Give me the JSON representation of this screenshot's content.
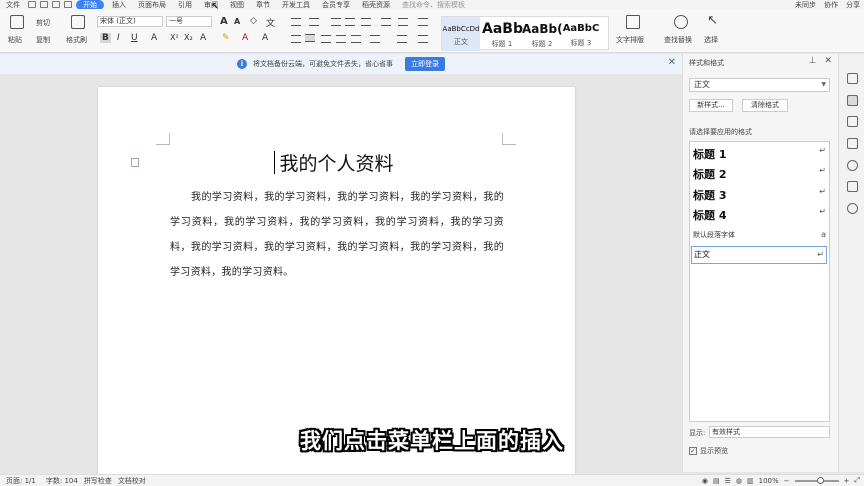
{
  "menubar": {
    "file": "文件",
    "tabs": [
      "开始",
      "插入",
      "页面布局",
      "引用",
      "审阅",
      "视图",
      "章节",
      "开发工具",
      "会员专享",
      "稻壳资源"
    ],
    "active_tab_index": 0,
    "search": "查找命令、搜索模板",
    "right": [
      "未同步",
      "协作",
      "分享"
    ]
  },
  "ribbon": {
    "paste": "粘贴",
    "cut": "剪切",
    "copy": "复制",
    "format_painter": "格式刷",
    "font_name": "宋体 (正文)",
    "font_size": "一号",
    "styles": [
      {
        "sample": "AaBbCcDd",
        "name": "正文"
      },
      {
        "sample": "AaBb",
        "name": "标题 1"
      },
      {
        "sample": "AaBb(",
        "name": "标题 2"
      },
      {
        "sample": "AaBbC",
        "name": "标题 3"
      }
    ],
    "text_layout": "文字排版",
    "find_replace": "查找替换",
    "select": "选择"
  },
  "notification": {
    "message": "将文档备份云端，可避免文件丢失，省心省事",
    "login": "立即登录"
  },
  "document": {
    "title": "我的个人资料",
    "body": "我的学习资料，我的学习资料，我的学习资料，我的学习资料，我的学习资料，我的学习资料，我的学习资料，我的学习资料，我的学习资料，我的学习资料，我的学习资料，我的学习资料，我的学习资料，我的学习资料，我的学习资料。"
  },
  "panel": {
    "title": "样式和格式",
    "current_style": "正文",
    "new_style": "新样式...",
    "clear_format": "清除格式",
    "apply_label": "请选择要应用的格式",
    "styles": [
      "标题 1",
      "标题 2",
      "标题 3",
      "标题 4"
    ],
    "default_font": "默认段落字体",
    "selected": "正文",
    "show_label": "显示:",
    "show_value": "有效样式",
    "preview": "显示预览"
  },
  "statusbar": {
    "page": "页面: 1/1",
    "words": "字数: 104",
    "spell": "拼写检查",
    "proof": "文档校对",
    "zoom": "100%"
  },
  "subtitle": "我们点击菜单栏上面的插入"
}
